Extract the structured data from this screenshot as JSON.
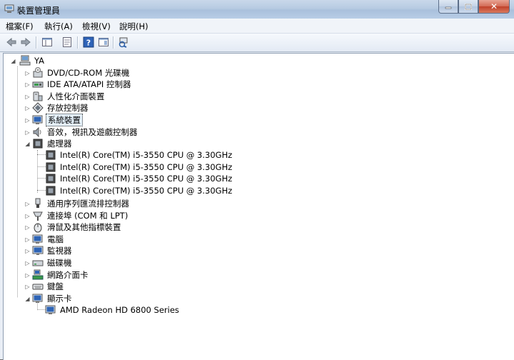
{
  "window": {
    "title": "裝置管理員",
    "close_glyph": "✕"
  },
  "menu": {
    "file": "檔案(F)",
    "action": "執行(A)",
    "view": "檢視(V)",
    "help": "說明(H)"
  },
  "tree": {
    "root": "YA",
    "cats": {
      "dvd": "DVD/CD-ROM 光碟機",
      "ide": "IDE ATA/ATAPI 控制器",
      "hid": "人性化介面裝置",
      "storage": "存放控制器",
      "system": "系統裝置",
      "sound": "音效，視訊及遊戲控制器",
      "cpu": "處理器",
      "usb": "通用序列匯流排控制器",
      "ports": "連接埠 (COM 和 LPT)",
      "mouse": "滑鼠及其他指標裝置",
      "computer": "電腦",
      "monitor": "監視器",
      "disk": "磁碟機",
      "network": "網路介面卡",
      "keyboard": "鍵盤",
      "display": "顯示卡"
    },
    "cpus": [
      "Intel(R) Core(TM) i5-3550 CPU @ 3.30GHz",
      "Intel(R) Core(TM) i5-3550 CPU @ 3.30GHz",
      "Intel(R) Core(TM) i5-3550 CPU @ 3.30GHz",
      "Intel(R) Core(TM) i5-3550 CPU @ 3.30GHz"
    ],
    "gpu": "AMD Radeon HD 6800 Series"
  }
}
